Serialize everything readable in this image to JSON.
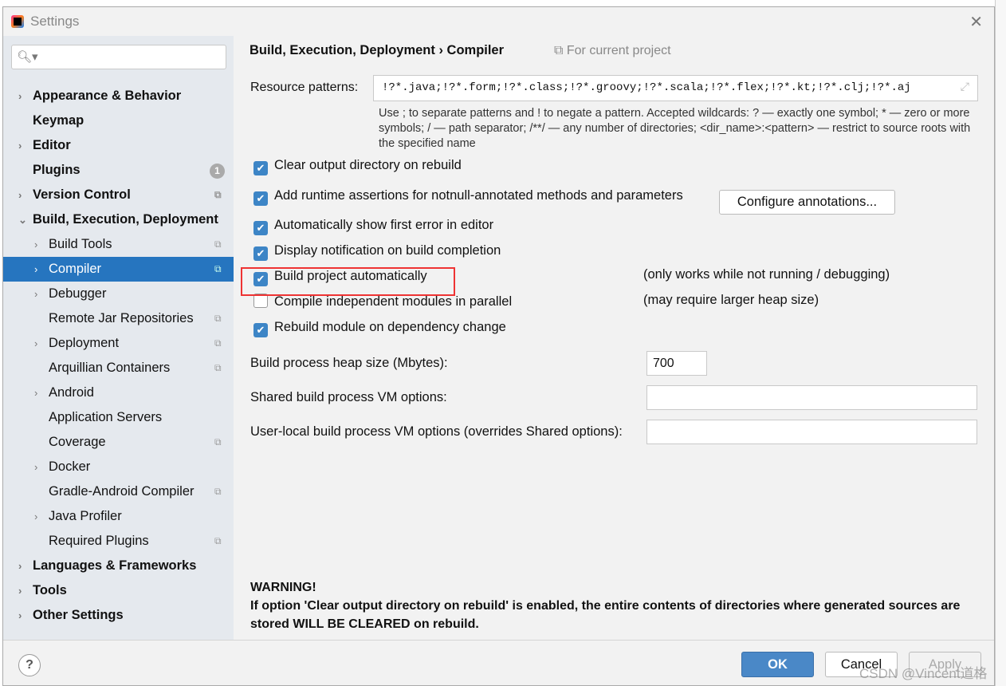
{
  "window": {
    "title": "Settings"
  },
  "search": {
    "placeholder": ""
  },
  "tree": [
    {
      "label": "Appearance & Behavior",
      "level": 0,
      "bold": true,
      "arrow": "›"
    },
    {
      "label": "Keymap",
      "level": 0,
      "bold": true,
      "arrow": ""
    },
    {
      "label": "Editor",
      "level": 0,
      "bold": true,
      "arrow": "›"
    },
    {
      "label": "Plugins",
      "level": 0,
      "bold": true,
      "arrow": "",
      "badge": "1"
    },
    {
      "label": "Version Control",
      "level": 0,
      "bold": true,
      "arrow": "›",
      "copy": true
    },
    {
      "label": "Build, Execution, Deployment",
      "level": 0,
      "bold": true,
      "arrow": "⌄"
    },
    {
      "label": "Build Tools",
      "level": 1,
      "arrow": "›",
      "copy": true
    },
    {
      "label": "Compiler",
      "level": 1,
      "arrow": "›",
      "copy": true,
      "selected": true
    },
    {
      "label": "Debugger",
      "level": 1,
      "arrow": "›"
    },
    {
      "label": "Remote Jar Repositories",
      "level": 1,
      "arrow": "",
      "copy": true
    },
    {
      "label": "Deployment",
      "level": 1,
      "arrow": "›",
      "copy": true
    },
    {
      "label": "Arquillian Containers",
      "level": 1,
      "arrow": "",
      "copy": true
    },
    {
      "label": "Android",
      "level": 1,
      "arrow": "›"
    },
    {
      "label": "Application Servers",
      "level": 1,
      "arrow": ""
    },
    {
      "label": "Coverage",
      "level": 1,
      "arrow": "",
      "copy": true
    },
    {
      "label": "Docker",
      "level": 1,
      "arrow": "›"
    },
    {
      "label": "Gradle-Android Compiler",
      "level": 1,
      "arrow": "",
      "copy": true
    },
    {
      "label": "Java Profiler",
      "level": 1,
      "arrow": "›"
    },
    {
      "label": "Required Plugins",
      "level": 1,
      "arrow": "",
      "copy": true
    },
    {
      "label": "Languages & Frameworks",
      "level": 0,
      "bold": true,
      "arrow": "›"
    },
    {
      "label": "Tools",
      "level": 0,
      "bold": true,
      "arrow": "›"
    },
    {
      "label": "Other Settings",
      "level": 0,
      "bold": true,
      "arrow": "›"
    }
  ],
  "main": {
    "breadcrumb": "Build, Execution, Deployment  ›  Compiler",
    "scope": "⧉ For current project",
    "resource_label": "Resource patterns:",
    "resource_value": "!?*.java;!?*.form;!?*.class;!?*.groovy;!?*.scala;!?*.flex;!?*.kt;!?*.clj;!?*.aj",
    "hint": "Use ; to separate patterns and ! to negate a pattern. Accepted wildcards: ? — exactly one symbol; * — zero or more symbols; / — path separator; /**/ — any number of directories; <dir_name>:<pattern> — restrict to source roots with the specified name",
    "checkboxes": [
      {
        "label": "Clear output directory on rebuild",
        "checked": true
      },
      {
        "label": "Add runtime assertions for notnull-annotated methods and parameters",
        "checked": true
      },
      {
        "label": "Automatically show first error in editor",
        "checked": true
      },
      {
        "label": "Display notification on build completion",
        "checked": true
      },
      {
        "label": "Build project automatically",
        "checked": true,
        "note": "(only works while not running / debugging)"
      },
      {
        "label": "Compile independent modules in parallel",
        "checked": false,
        "note": "(may require larger heap size)"
      },
      {
        "label": "Rebuild module on dependency change",
        "checked": true
      }
    ],
    "configure_button": "Configure annotations...",
    "heap_label": "Build process heap size (Mbytes):",
    "heap_value": "700",
    "shared_label": "Shared build process VM options:",
    "shared_value": "",
    "local_label": "User-local build process VM options (overrides Shared options):",
    "local_value": "",
    "warning_title": "WARNING!",
    "warning_text": "If option 'Clear output directory on rebuild' is enabled, the entire contents of directories where generated sources are stored WILL BE CLEARED on rebuild."
  },
  "footer": {
    "help": "?",
    "ok": "OK",
    "cancel": "Cancel",
    "apply": "Apply"
  },
  "watermark": "CSDN @Vincent道格",
  "colors": {
    "selection": "#2675bf",
    "checkbox": "#3d85c6",
    "highlight": "#ee3333"
  }
}
